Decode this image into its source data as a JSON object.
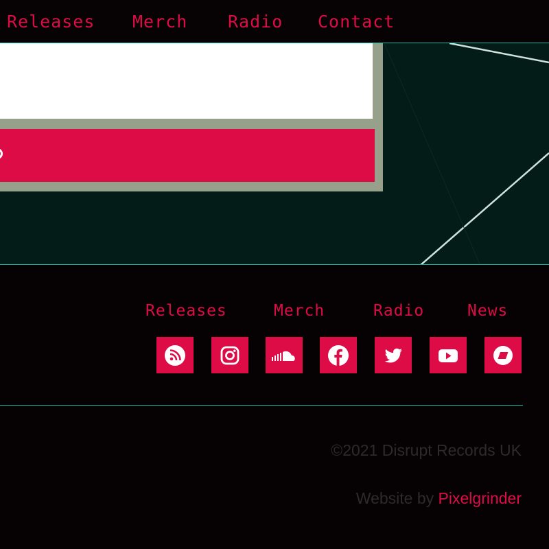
{
  "colors": {
    "accent": "#dd0c47",
    "teal_line": "#1bb49a",
    "hero_bg": "#031c17",
    "page_bg": "#060204",
    "form_frame": "#97a08b",
    "muted_text": "#2e2a2c"
  },
  "top_nav": {
    "items": [
      "Releases",
      "Merch",
      "Radio",
      "Contact"
    ]
  },
  "hero": {
    "input_value": "",
    "submit_icon": "submit-arrow-icon"
  },
  "footer": {
    "nav": [
      "Releases",
      "Merch",
      "Radio",
      "News"
    ],
    "social_icons": [
      "rss-icon",
      "instagram-icon",
      "soundcloud-icon",
      "facebook-icon",
      "twitter-icon",
      "youtube-icon",
      "bandcamp-icon"
    ],
    "copyright": "©2021 Disrupt Records UK",
    "credit_prefix": "Website by",
    "credit_link": "Pixelgrinder"
  }
}
